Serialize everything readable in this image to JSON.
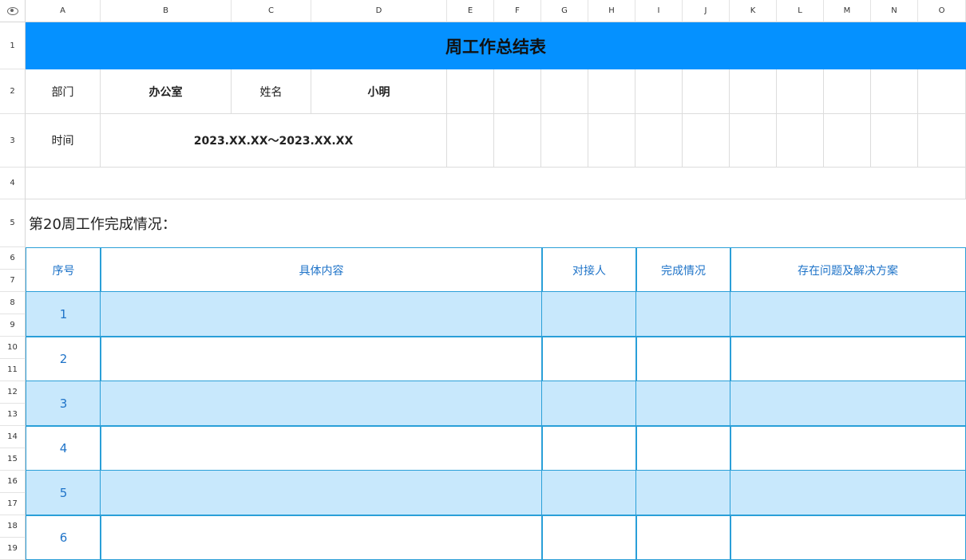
{
  "columns": [
    "A",
    "B",
    "C",
    "D",
    "E",
    "F",
    "G",
    "H",
    "I",
    "J",
    "K",
    "L",
    "M",
    "N",
    "O"
  ],
  "rows": [
    "1",
    "2",
    "3",
    "4",
    "5",
    "6",
    "7",
    "8",
    "9",
    "10",
    "11",
    "12",
    "13",
    "14",
    "15",
    "16",
    "17",
    "18",
    "19"
  ],
  "sheet": {
    "title": "周工作总结表",
    "dept_label": "部门",
    "dept_value": "办公室",
    "name_label": "姓名",
    "name_value": "小明",
    "time_label": "时间",
    "time_value": "2023.XX.XX～2023.XX.XX",
    "section_label": "第20周工作完成情况：",
    "table_headers": [
      "序号",
      "具体内容",
      "对接人",
      "完成情况",
      "存在问题及解决方案"
    ],
    "table_rows": [
      "1",
      "2",
      "3",
      "4",
      "5",
      "6"
    ]
  },
  "colors": {
    "title_bar": "#0591ff",
    "row_stripe": "#c8e8fc",
    "table_border": "#2a9fd8",
    "header_text": "#1e73c8"
  }
}
